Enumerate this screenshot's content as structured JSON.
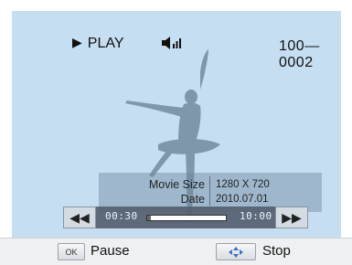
{
  "osd": {
    "mode_label": "PLAY",
    "file_number": "100—0002",
    "play_icon": "play-triangle-icon",
    "volume_icon": "speaker-volume-icon"
  },
  "info": {
    "movie_size_label": "Movie Size",
    "movie_size_value": "1280 X 720",
    "date_label": "Date",
    "date_value": "2010.07.01"
  },
  "controls": {
    "rewind_icon": "rewind-icon",
    "forward_icon": "fast-forward-icon",
    "elapsed": "00:30",
    "total": "10:00",
    "progress": 0.05
  },
  "bottom_bar": {
    "ok_key": "OK",
    "ok_action": "Pause",
    "nav_icon": "directional-pad-icon",
    "nav_action": "Stop"
  }
}
